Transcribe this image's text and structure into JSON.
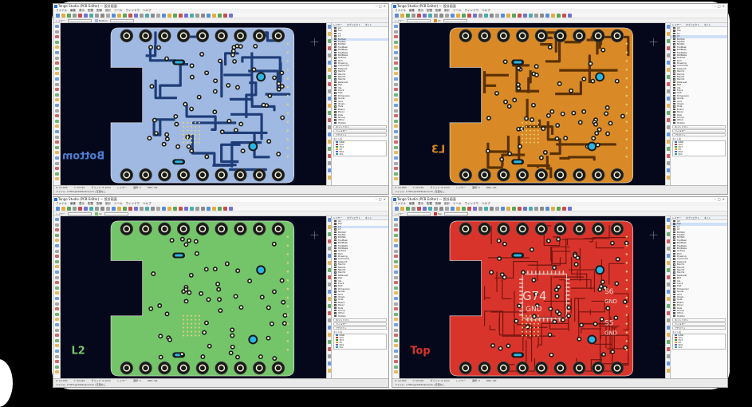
{
  "app": {
    "title": "Tango Studio (PCB Editor) — 設計画面",
    "menu": [
      "ファイル",
      "編集",
      "表示",
      "配置",
      "配線",
      "設計",
      "ツール",
      "ウィンドウ",
      "ヘルプ"
    ],
    "option_label": "レイヤー",
    "panel_tabs": [
      "レイヤー",
      "オブジェクト",
      "ネット"
    ],
    "layers": [
      "All",
      "Top",
      "L2",
      "L3",
      "Bottom",
      "TopSilk",
      "BotSilk",
      "TopMask",
      "BotMask",
      "TopPaste",
      "BotPaste",
      "Outline",
      "Drill",
      "Drawing",
      "Comment",
      "Keepout",
      "Mech1",
      "Mech2",
      "Mech3",
      "Mech4",
      "Ratsnest",
      "Pad",
      "Via",
      "Track",
      "Text",
      "Dimension",
      "Guide",
      "Grid",
      "Origin",
      "Hole",
      "Board",
      "Panel",
      "Rule",
      "Group",
      "Other",
      "Hidden"
    ],
    "panel_boxes": [
      "ネットリスト",
      "フィルター",
      "プロパティ"
    ],
    "panel_head": "ネット名",
    "nets": [
      "GND",
      "VCC",
      "3V3",
      "5V",
      "SDA",
      "SCL",
      "TX",
      "RX"
    ],
    "status": [
      "X: 12.450",
      "Y: 33.210",
      "グリッド: 0.1mm",
      "レイヤー",
      "選択: 0",
      "DRC: OK"
    ],
    "status_line": "ファイル: C:¥Projects¥board.pcb  |  変更なし"
  },
  "windows": [
    {
      "id": "bottom",
      "layer_name": "Bottom",
      "active_layer": 4,
      "board_color": "#9fb9e2",
      "trace_color": "#1e3d78",
      "label_color": "#4d7cd1"
    },
    {
      "id": "l3",
      "layer_name": "L3",
      "active_layer": 3,
      "board_color": "#d98a26",
      "trace_color": "#5a3104",
      "label_color": "#d98a26"
    },
    {
      "id": "l2",
      "layer_name": "L2",
      "active_layer": 2,
      "board_color": "#74c56a",
      "trace_color": "#234d1e",
      "label_color": "#74c56a"
    },
    {
      "id": "top",
      "layer_name": "Top",
      "active_layer": 1,
      "board_color": "#d9342b",
      "trace_color": "#741510",
      "label_color": "#d9342b",
      "silk_labels": [
        "G74",
        "GND",
        "S6",
        "GND",
        "S5",
        "GND"
      ]
    }
  ],
  "colors": {
    "canvas_bg": "#04081a",
    "pad_ring": "#1a1a1a",
    "pad_hole": "#f4f4d8",
    "via_cyan": "#2ab7e6",
    "dot_yellow": "#e6d27a"
  }
}
